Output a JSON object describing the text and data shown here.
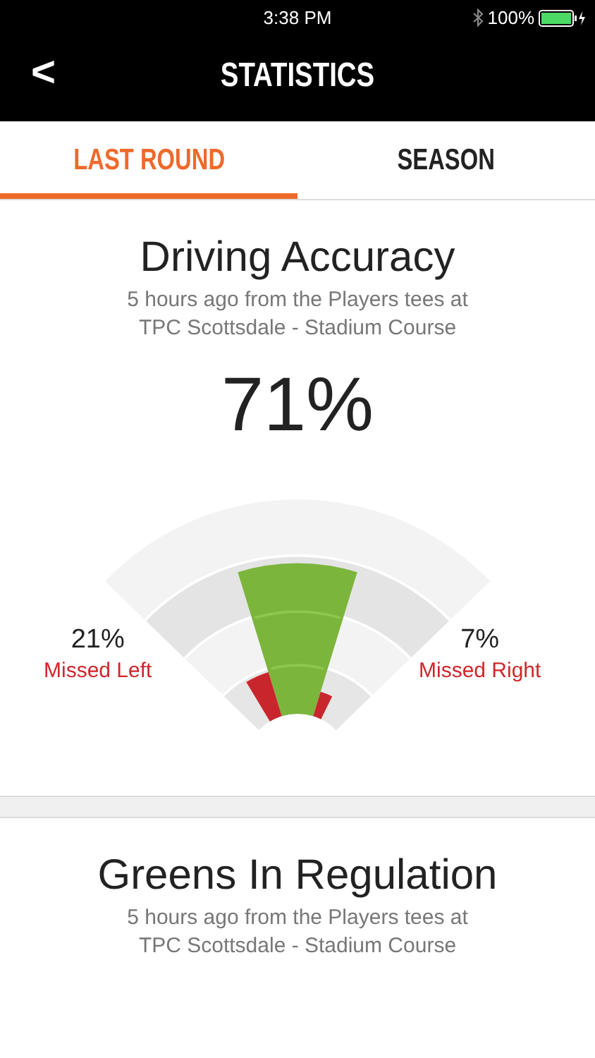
{
  "status_bar": {
    "time": "3:38 PM",
    "battery": "100%"
  },
  "nav": {
    "back": "<",
    "title": "STATISTICS"
  },
  "tabs": [
    {
      "label": "LAST ROUND",
      "selected": true
    },
    {
      "label": "SEASON",
      "selected": false
    }
  ],
  "cards": [
    {
      "kind": "gauge",
      "title": "Driving Accuracy",
      "subtitle_lines": [
        "5 hours ago from the Players tees at",
        "TPC Scottsdale - Stadium Course"
      ],
      "value": "71%",
      "left": {
        "value": "21%",
        "label": "Missed Left"
      },
      "right": {
        "value": "7%",
        "label": "Missed Right"
      }
    },
    {
      "kind": "plain",
      "title": "Greens In Regulation",
      "subtitle_lines": [
        "5 hours ago from the Players tees at",
        "TPC Scottsdale - Stadium Course"
      ]
    }
  ]
}
